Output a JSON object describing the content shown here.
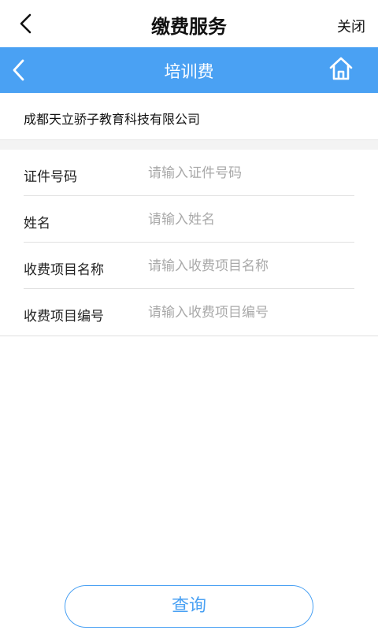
{
  "topbar": {
    "back_icon": "chevron-left-icon",
    "title": "缴费服务",
    "close_label": "关闭"
  },
  "navbar": {
    "back_icon": "chevron-left-icon",
    "title": "培训费",
    "home_icon": "home-icon",
    "background": "#4aa1f3"
  },
  "company": {
    "name": "成都天立骄子教育科技有限公司"
  },
  "form": {
    "fields": [
      {
        "label": "证件号码",
        "placeholder": "请输入证件号码",
        "value": ""
      },
      {
        "label": "姓名",
        "placeholder": "请输入姓名",
        "value": ""
      },
      {
        "label": "收费项目名称",
        "placeholder": "请输入收费项目名称",
        "value": ""
      },
      {
        "label": "收费项目编号",
        "placeholder": "请输入收费项目编号",
        "value": ""
      }
    ]
  },
  "actions": {
    "query_label": "查询",
    "accent": "#4aa1f3"
  }
}
